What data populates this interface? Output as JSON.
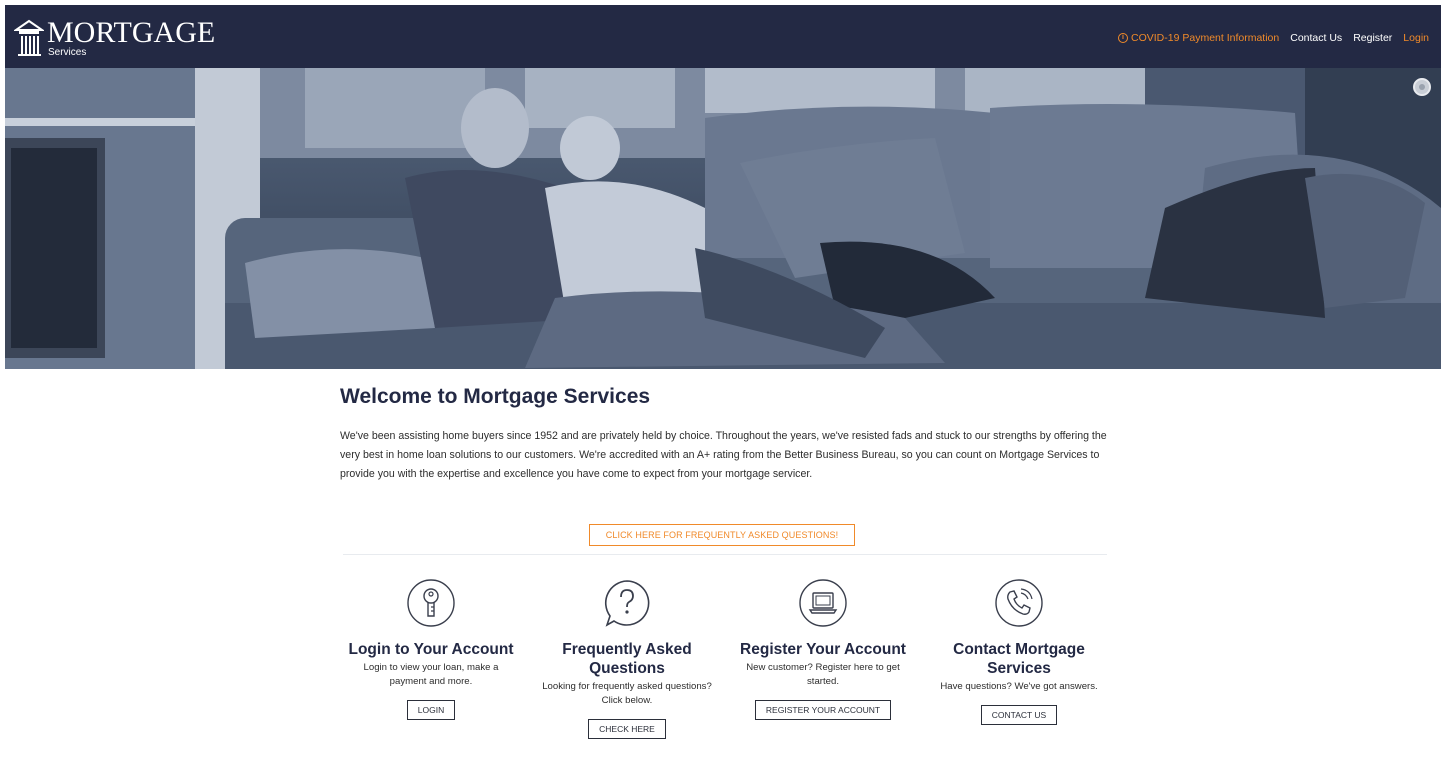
{
  "brand": {
    "name": "MORTGAGE",
    "sub": "Services"
  },
  "nav": {
    "covid": "COVID-19 Payment Information",
    "contact": "Contact Us",
    "register": "Register",
    "login": "Login"
  },
  "welcome": {
    "title": "Welcome to Mortgage Services",
    "body": "We've been assisting home buyers since 1952 and are privately held by choice. Throughout the years, we've resisted fads and stuck to our strengths by offering the very best in home loan solutions to our customers. We're accredited with an A+ rating from the Better Business Bureau, so you can count on Mortgage Services to provide you with the expertise and excellence you have come to expect from your mortgage servicer."
  },
  "faq_button": "CLICK HERE FOR FREQUENTLY ASKED QUESTIONS!",
  "cards": [
    {
      "icon": "key-icon",
      "title": "Login to Your Account",
      "desc": "Login to view your loan, make a payment and more.",
      "button": "LOGIN"
    },
    {
      "icon": "question-bubble-icon",
      "title": "Frequently Asked Questions",
      "desc": "Looking for frequently asked questions? Click below.",
      "button": "CHECK HERE"
    },
    {
      "icon": "laptop-icon",
      "title": "Register Your Account",
      "desc": "New customer? Register here to get started.",
      "button": "REGISTER YOUR ACCOUNT"
    },
    {
      "icon": "phone-icon",
      "title": "Contact Mortgage Services",
      "desc": "Have questions? We've got answers.",
      "button": "CONTACT US"
    }
  ],
  "colors": {
    "navy": "#232944",
    "accent": "#f08a2a",
    "hero_tint": "#3c4a60"
  }
}
